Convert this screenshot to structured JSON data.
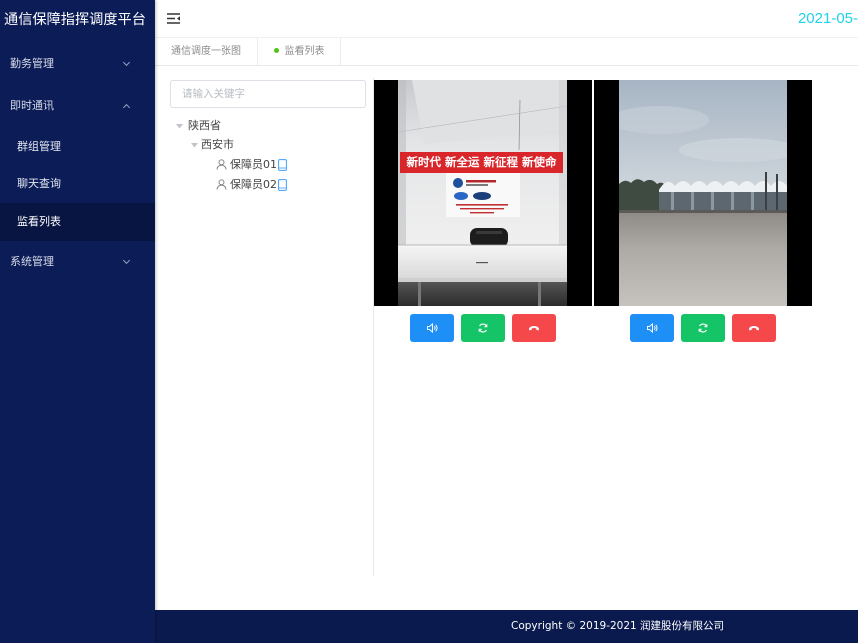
{
  "app": {
    "title": "通信保障指挥调度平台",
    "date": "2021-05-"
  },
  "colors": {
    "sidebar_bg": "#0c1c57",
    "sidebar_active_bg": "#081441",
    "date_accent": "#1fd2e8",
    "active_tab_dot": "#52c41a",
    "footer_bg": "#0b1a4e"
  },
  "header": {
    "menu_toggle_icon": "fold-menu-icon"
  },
  "sidebar": {
    "items": [
      {
        "label": "勤务管理",
        "icon": "chevron-down-icon",
        "expanded": false
      },
      {
        "label": "即时通讯",
        "icon": "chevron-up-icon",
        "expanded": true,
        "children": [
          {
            "label": "群组管理"
          },
          {
            "label": "聊天查询"
          },
          {
            "label": "监看列表",
            "active": true
          }
        ]
      },
      {
        "label": "系统管理",
        "icon": "chevron-down-icon",
        "expanded": false
      }
    ]
  },
  "tabs": [
    {
      "label": "通信调度一张图",
      "active": false
    },
    {
      "label": "监看列表",
      "active": true
    }
  ],
  "search": {
    "placeholder": "请输入关键字",
    "value": ""
  },
  "tree": {
    "nodes": [
      {
        "label": "陕西省",
        "expanded": true,
        "children": [
          {
            "label": "西安市",
            "expanded": true,
            "children": [
              {
                "label": "保障员01",
                "icon": "user-icon",
                "device_icon": "mobile-icon"
              },
              {
                "label": "保障员02",
                "icon": "user-icon",
                "device_icon": "mobile-icon"
              }
            ]
          }
        ]
      }
    ]
  },
  "video_panels": [
    {
      "banner_text": "新时代 新全运 新征程 新使命",
      "controls": [
        {
          "icon": "speaker-icon",
          "color": "#1e8ff7"
        },
        {
          "icon": "refresh-icon",
          "color": "#15c466"
        },
        {
          "icon": "hangup-icon",
          "color": "#f5484a"
        }
      ]
    },
    {
      "controls": [
        {
          "icon": "speaker-icon",
          "color": "#1e8ff7"
        },
        {
          "icon": "refresh-icon",
          "color": "#15c466"
        },
        {
          "icon": "hangup-icon",
          "color": "#f5484a"
        }
      ]
    }
  ],
  "footer": {
    "copyright": "Copyright © 2019-2021 润建股份有限公司"
  }
}
